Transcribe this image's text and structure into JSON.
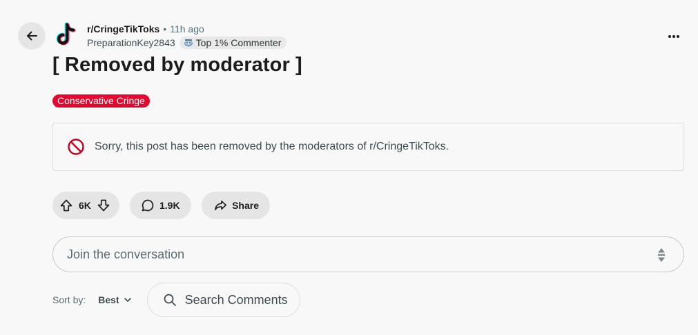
{
  "post": {
    "subreddit": "r/CringeTikToks",
    "separator": "•",
    "time_ago": "11h ago",
    "author": "PreparationKey2843",
    "author_flair": "Top 1% Commenter",
    "title": "[ Removed by moderator ]",
    "post_flair": "Conservative Cringe",
    "removed_message": "Sorry, this post has been removed by the moderators of r/CringeTikToks."
  },
  "actions": {
    "upvotes": "6K",
    "comments": "1.9K",
    "share_label": "Share"
  },
  "comment_box": {
    "placeholder": "Join the conversation"
  },
  "sort": {
    "label": "Sort by:",
    "value": "Best"
  },
  "search": {
    "placeholder": "Search Comments"
  },
  "colors": {
    "post_flair_bg": "#e8062f",
    "removed_icon": "#c4001d",
    "background": "#f8f8f8"
  },
  "icons": {
    "back": "arrow-left-icon",
    "more": "ellipsis-icon",
    "removed": "prohibited-icon",
    "upvote": "arrow-up-icon",
    "downvote": "arrow-down-icon",
    "comment": "speech-bubble-icon",
    "share": "share-arrow-icon",
    "sort": "chevron-down-icon",
    "search": "search-icon"
  }
}
